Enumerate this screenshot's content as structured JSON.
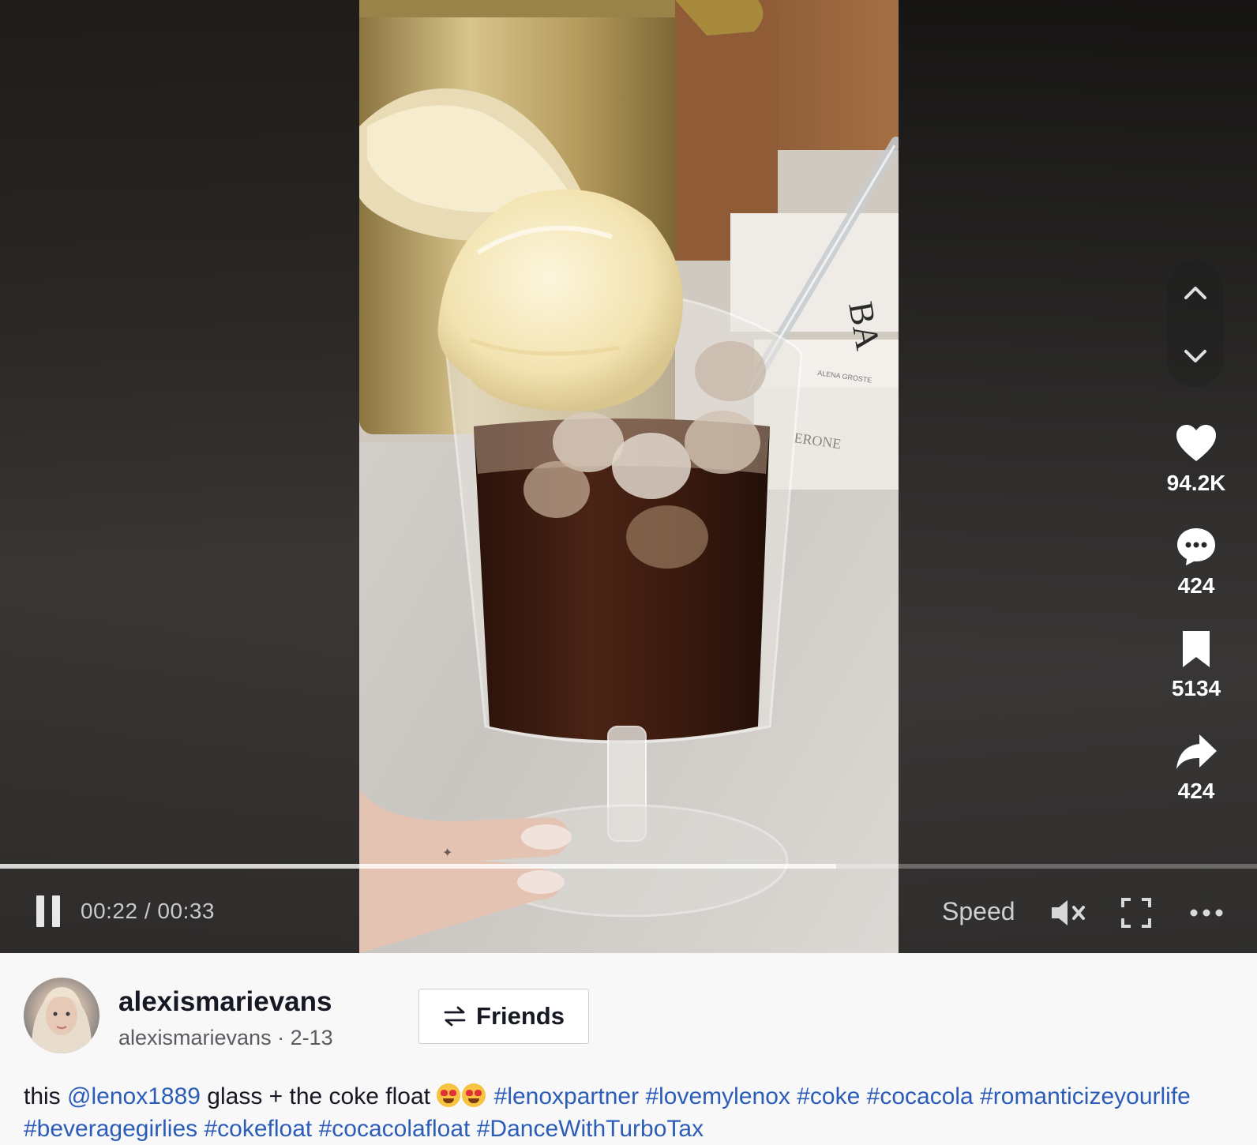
{
  "player": {
    "progress_fraction": 0.665,
    "current_time": "00:22",
    "duration": "00:33",
    "time_separator": " / ",
    "speed_label": "Speed"
  },
  "actions": {
    "likes": "94.2K",
    "comments": "424",
    "saves": "5134",
    "shares": "424"
  },
  "author": {
    "username": "alexismarievans",
    "handle": "alexismarievans",
    "date_separator": " · ",
    "date": "2-13"
  },
  "follow": {
    "label": "Friends"
  },
  "caption": {
    "text_1": "this ",
    "mention": "@lenox1889",
    "text_2": " glass + the coke float ",
    "emojis": "😍😍",
    "hashtags": [
      "#lenoxpartner",
      "#lovemylenox",
      "#coke",
      "#cocacola",
      "#romanticizeyourlife",
      "#beveragegirlies",
      "#cokefloat",
      "#cocacolafloat",
      "#DanceWithTurboTax"
    ]
  },
  "colors": {
    "link": "#2b5db8",
    "text": "#161823",
    "player_bg": "#2a2725"
  },
  "icons": [
    "pause-icon",
    "chevron-up-icon",
    "chevron-down-icon",
    "heart-icon",
    "comment-icon",
    "bookmark-icon",
    "share-icon",
    "mute-icon",
    "fullscreen-icon",
    "more-icon",
    "swap-arrows-icon"
  ]
}
